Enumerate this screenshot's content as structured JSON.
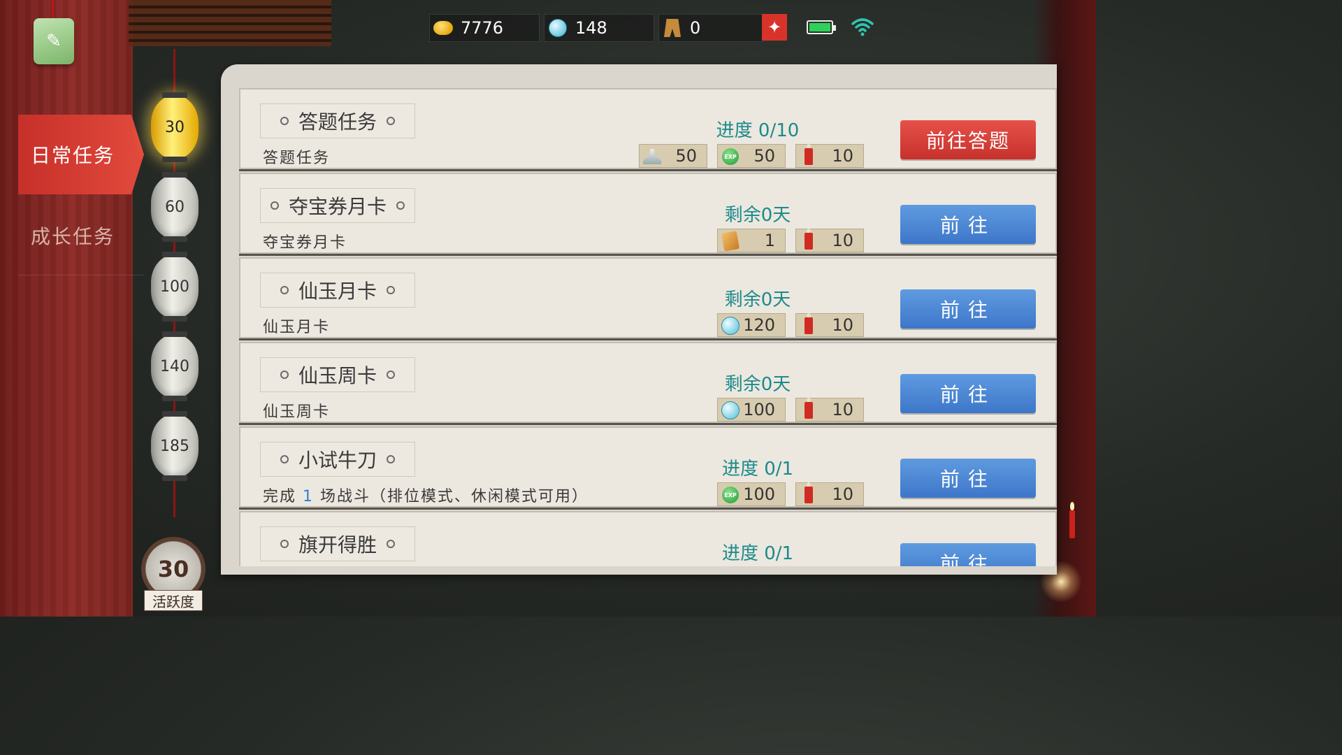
{
  "topbar": {
    "gold": "7776",
    "jade": "148",
    "tower": "0",
    "star_icon": "sparkle-icon",
    "battery_level": 1.0,
    "accent_color": "#d8332b"
  },
  "sidebar": {
    "tabs": [
      {
        "label": "日常任务",
        "active": true
      },
      {
        "label": "成长任务",
        "active": false
      }
    ]
  },
  "activity": {
    "milestones": [
      "30",
      "60",
      "100",
      "140",
      "185"
    ],
    "reached_index": 0,
    "current": "30",
    "label": "活跃度"
  },
  "tasks": [
    {
      "name": "答题任务",
      "desc": "答题任务",
      "status": "进度  0/10",
      "rewards": [
        {
          "icon": "token-icon",
          "value": "50"
        },
        {
          "icon": "exp-icon",
          "value": "50"
        },
        {
          "icon": "candle-icon",
          "value": "10"
        }
      ],
      "button": "前往答题",
      "button_style": "red"
    },
    {
      "name": "夺宝券月卡",
      "desc": "夺宝券月卡",
      "status": "剩余0天",
      "rewards": [
        {
          "icon": "ticket-icon",
          "value": "1"
        },
        {
          "icon": "candle-icon",
          "value": "10"
        }
      ],
      "button": "前往",
      "button_style": "blue"
    },
    {
      "name": "仙玉月卡",
      "desc": "仙玉月卡",
      "status": "剩余0天",
      "rewards": [
        {
          "icon": "jade-icon",
          "value": "120"
        },
        {
          "icon": "candle-icon",
          "value": "10"
        }
      ],
      "button": "前往",
      "button_style": "blue"
    },
    {
      "name": "仙玉周卡",
      "desc": "仙玉周卡",
      "status": "剩余0天",
      "rewards": [
        {
          "icon": "jade-icon",
          "value": "100"
        },
        {
          "icon": "candle-icon",
          "value": "10"
        }
      ],
      "button": "前往",
      "button_style": "blue"
    },
    {
      "name": "小试牛刀",
      "desc_prefix": "完成",
      "desc_highlight": "1",
      "desc_suffix": "场战斗（排位模式、休闲模式可用）",
      "status": "进度  0/1",
      "rewards": [
        {
          "icon": "exp-icon",
          "value": "100"
        },
        {
          "icon": "candle-icon",
          "value": "10"
        }
      ],
      "button": "前往",
      "button_style": "blue"
    },
    {
      "name": "旗开得胜",
      "desc": "",
      "status": "进度  0/1",
      "rewards": [],
      "button": "前往",
      "button_style": "blue"
    }
  ]
}
